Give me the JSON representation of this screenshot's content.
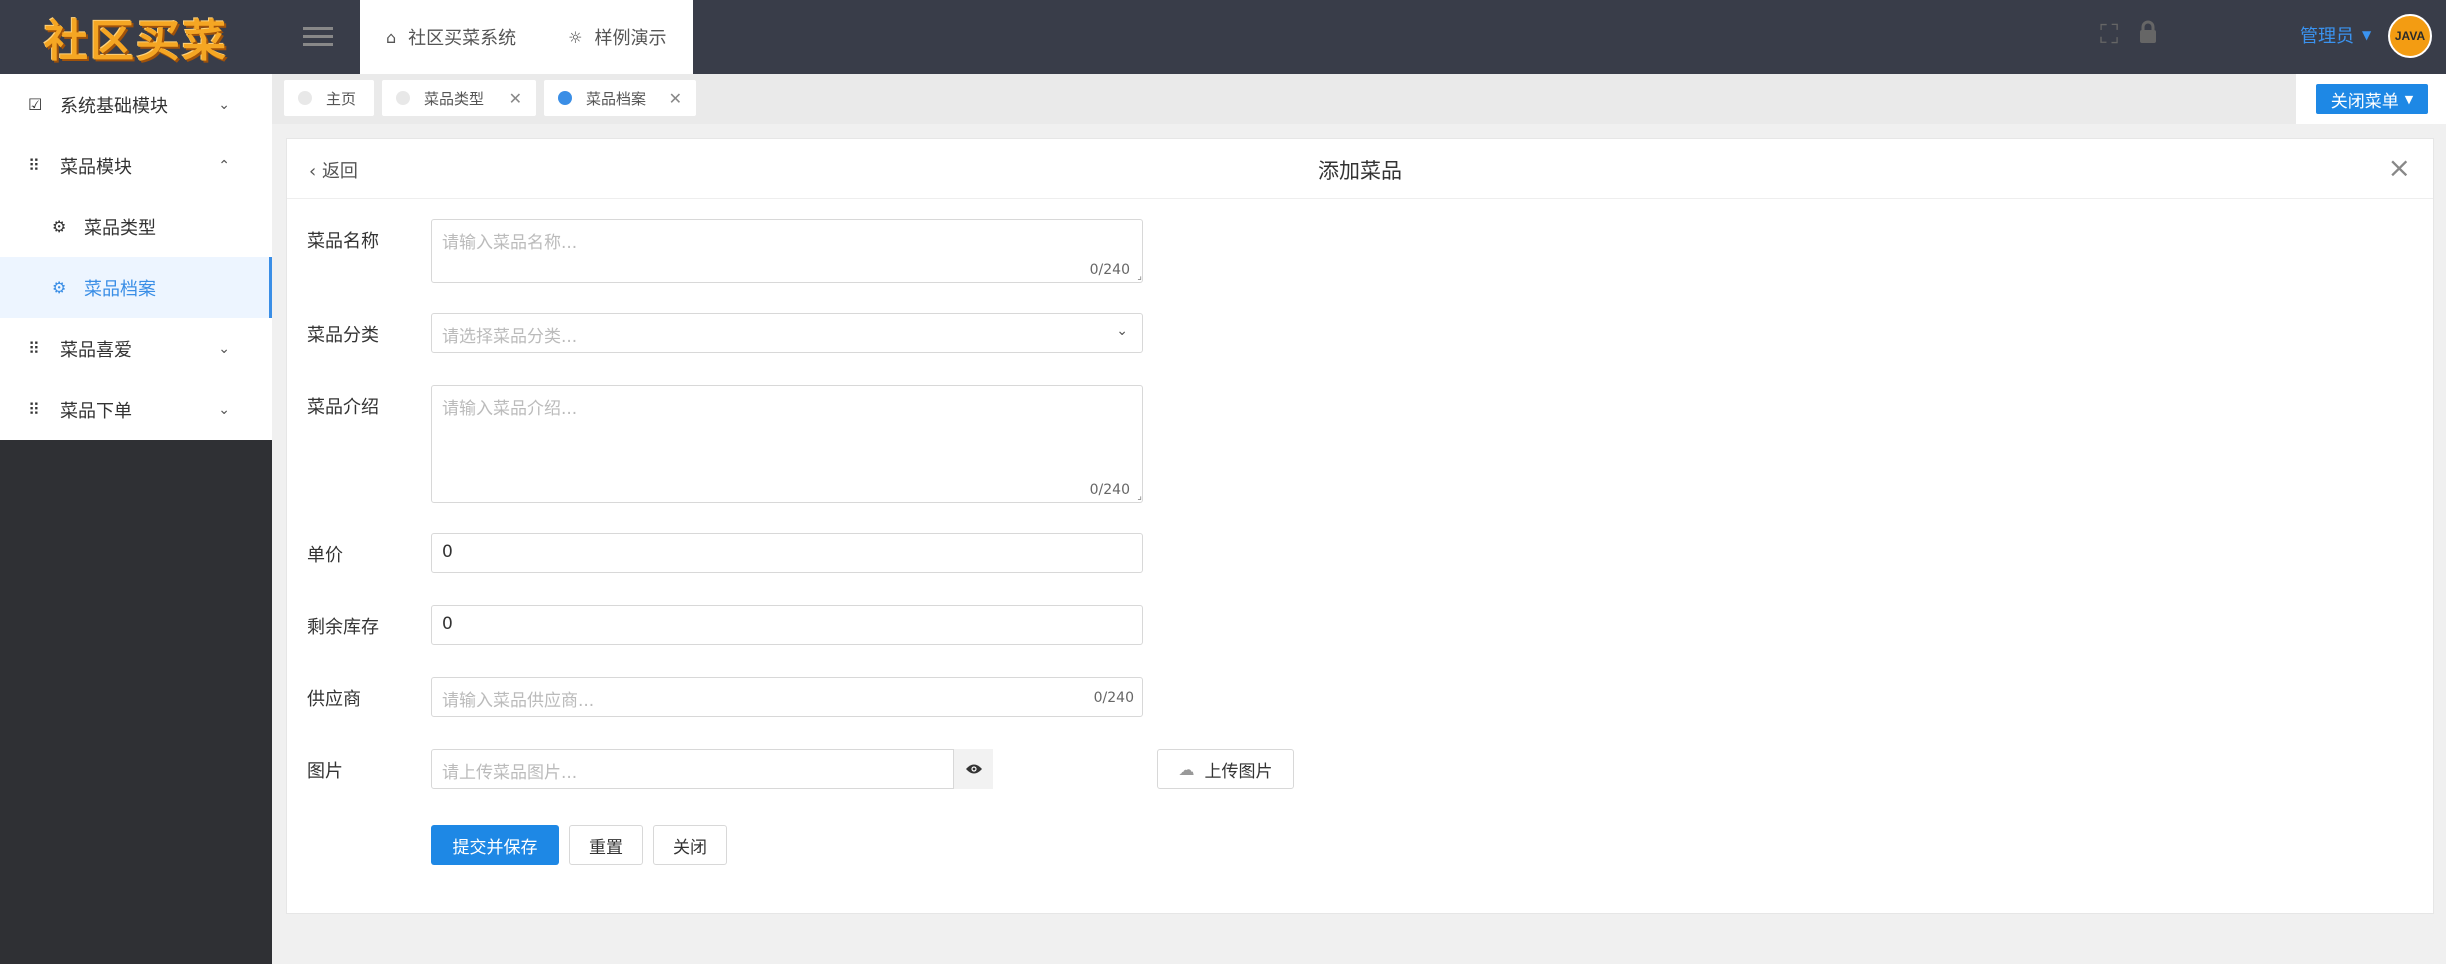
{
  "app": {
    "logo_text": "社区买菜"
  },
  "header": {
    "tabs": [
      {
        "label": "社区买菜系统",
        "icon": "home-icon"
      },
      {
        "label": "样例演示",
        "icon": "bulb-icon"
      }
    ],
    "user": "管理员",
    "avatar_text": "JAVA"
  },
  "sidebar": {
    "items": [
      {
        "label": "系统基础模块",
        "icon": "check-square-icon",
        "expanded": false
      },
      {
        "label": "菜品模块",
        "icon": "grid-icon",
        "expanded": true
      },
      {
        "label": "菜品类型",
        "icon": "settings-icon",
        "sub": true
      },
      {
        "label": "菜品档案",
        "icon": "settings-icon",
        "sub": true,
        "active": true
      },
      {
        "label": "菜品喜爱",
        "icon": "grid-icon",
        "expanded": false
      },
      {
        "label": "菜品下单",
        "icon": "grid-icon",
        "expanded": false
      }
    ]
  },
  "page_tabs": [
    {
      "label": "主页",
      "closable": false
    },
    {
      "label": "菜品类型",
      "closable": true
    },
    {
      "label": "菜品档案",
      "closable": true,
      "active": true
    }
  ],
  "close_menu_label": "关闭菜单",
  "form": {
    "back_label": "返回",
    "title": "添加菜品",
    "fields": {
      "name": {
        "label": "菜品名称",
        "placeholder": "请输入菜品名称...",
        "counter": "0/240"
      },
      "category": {
        "label": "菜品分类",
        "placeholder": "请选择菜品分类..."
      },
      "intro": {
        "label": "菜品介绍",
        "placeholder": "请输入菜品介绍...",
        "counter": "0/240"
      },
      "price": {
        "label": "单价",
        "value": "0"
      },
      "stock": {
        "label": "剩余库存",
        "value": "0"
      },
      "supplier": {
        "label": "供应商",
        "placeholder": "请输入菜品供应商...",
        "counter": "0/240"
      },
      "image": {
        "label": "图片",
        "placeholder": "请上传菜品图片...",
        "upload_label": "上传图片"
      }
    },
    "buttons": {
      "submit": "提交并保存",
      "reset": "重置",
      "close": "关闭"
    }
  },
  "colors": {
    "primary": "#1e88e5",
    "topbar": "#393d49",
    "sidebar": "#2f3034",
    "logo": "#f5a623"
  }
}
